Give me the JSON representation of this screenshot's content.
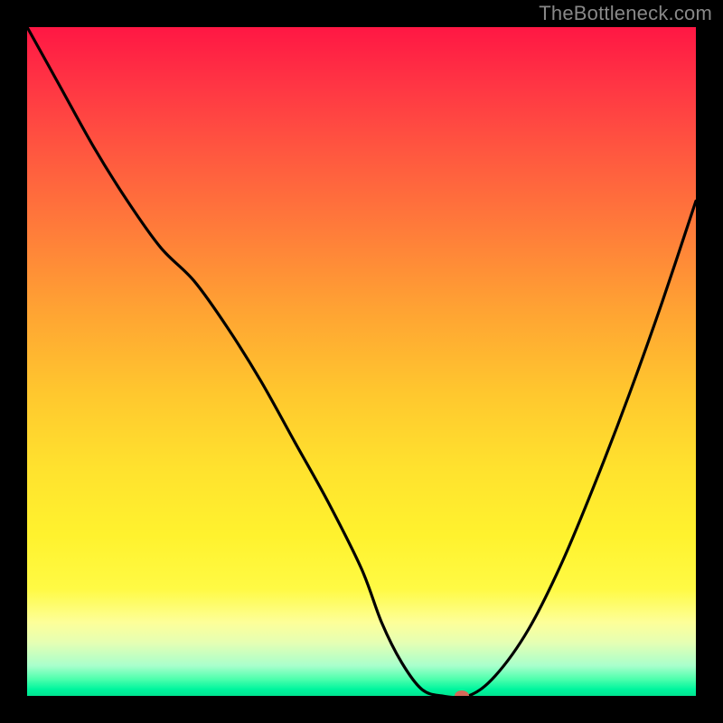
{
  "watermark": "TheBottleneck.com",
  "chart_data": {
    "type": "line",
    "title": "",
    "xlabel": "",
    "ylabel": "",
    "xlim": [
      0,
      100
    ],
    "ylim": [
      0,
      100
    ],
    "grid": false,
    "series": [
      {
        "name": "curve",
        "x": [
          0,
          5,
          10,
          15,
          20,
          25,
          30,
          35,
          40,
          45,
          50,
          53,
          56,
          59,
          62,
          66,
          70,
          75,
          80,
          85,
          90,
          95,
          100
        ],
        "y": [
          100,
          91,
          82,
          74,
          67,
          62,
          55,
          47,
          38,
          29,
          19,
          11,
          5,
          1,
          0,
          0,
          3,
          10,
          20,
          32,
          45,
          59,
          74
        ]
      }
    ],
    "marker": {
      "x": 65,
      "y": 0,
      "color": "#d46a5a"
    },
    "background_gradient": {
      "stops": [
        {
          "pos": 0,
          "color": "#ff1744"
        },
        {
          "pos": 50,
          "color": "#ffc82e"
        },
        {
          "pos": 85,
          "color": "#fdff99"
        },
        {
          "pos": 100,
          "color": "#00e590"
        }
      ]
    }
  }
}
